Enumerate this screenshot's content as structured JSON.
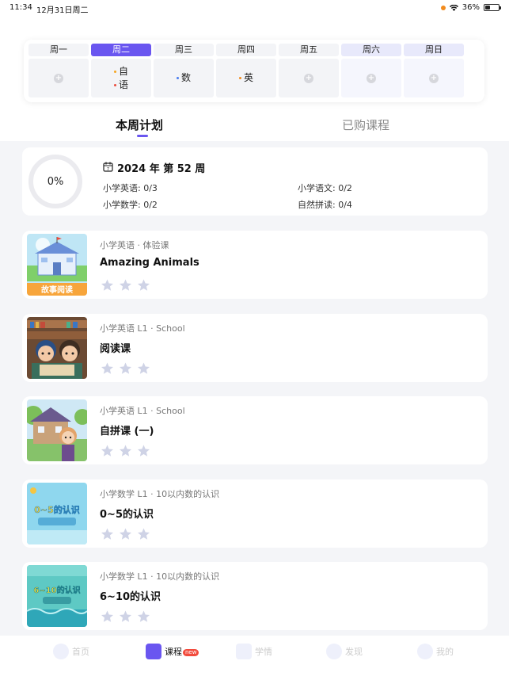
{
  "status": {
    "time": "11:34",
    "date": "12月31日周二",
    "battery": "36%",
    "battery_level": 0.36
  },
  "week": {
    "days": [
      {
        "label": "周一",
        "subjects": []
      },
      {
        "label": "周二",
        "subjects": [
          {
            "name": "自",
            "color": "#f5a623"
          },
          {
            "name": "语",
            "color": "#e94b3c"
          }
        ]
      },
      {
        "label": "周三",
        "subjects": [
          {
            "name": "数",
            "color": "#4a7df0"
          }
        ]
      },
      {
        "label": "周四",
        "subjects": [
          {
            "name": "英",
            "color": "#f28b1d"
          }
        ]
      },
      {
        "label": "周五",
        "subjects": []
      },
      {
        "label": "周六",
        "subjects": []
      },
      {
        "label": "周日",
        "subjects": []
      }
    ],
    "add_symbol": "+"
  },
  "tabs": [
    {
      "label": "本周计划"
    },
    {
      "label": "已购课程"
    }
  ],
  "summary": {
    "progress": "0%",
    "week_title": "2024 年 第 52 周",
    "stats": [
      "小学英语: 0/3",
      "小学语文: 0/2",
      "小学数学: 0/2",
      "自然拼读: 0/4"
    ]
  },
  "courses": [
    {
      "subtitle": "小学英语 · 体验课",
      "title": "Amazing Animals",
      "thumb_label": "故事阅读",
      "stars": 3
    },
    {
      "subtitle": "小学英语 L1 · School",
      "title": "阅读课",
      "stars": 3
    },
    {
      "subtitle": "小学英语 L1 · School",
      "title": "自拼课 (一)",
      "stars": 3
    },
    {
      "subtitle": "小学数学 L1 · 10以内数的认识",
      "title": "0~5的认识",
      "thumb_label": "0~5的认识",
      "stars": 3
    },
    {
      "subtitle": "小学数学 L1 · 10以内数的认识",
      "title": "6~10的认识",
      "thumb_label": "6~10的认识",
      "stars": 3
    }
  ],
  "nav": {
    "items": [
      {
        "label": "首页"
      },
      {
        "label": "课程",
        "badge": "new"
      },
      {
        "label": "学情"
      },
      {
        "label": "发现"
      },
      {
        "label": "我的"
      }
    ]
  },
  "colors": {
    "accent": "#6a56f0",
    "star": "#cfd3e6",
    "badge": "#f24b3d"
  }
}
